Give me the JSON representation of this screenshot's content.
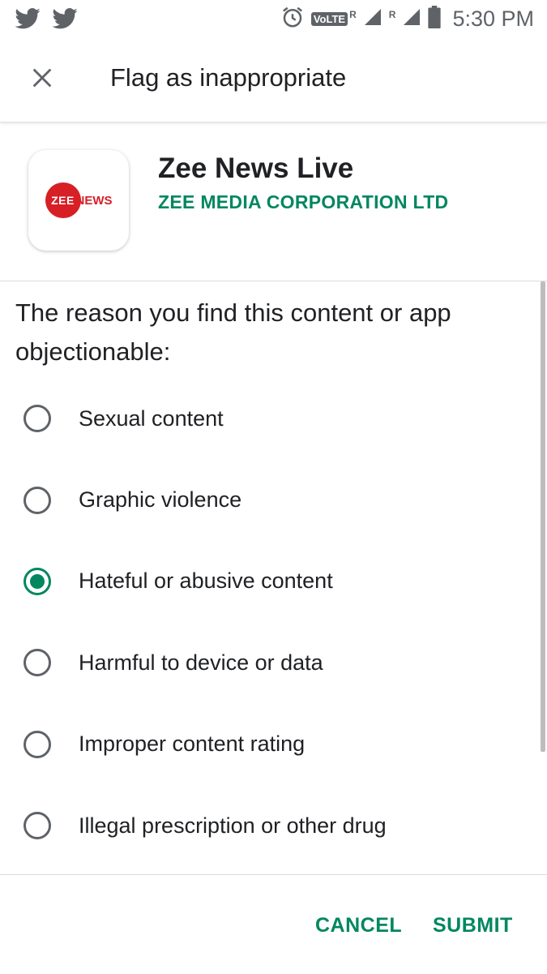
{
  "status_bar": {
    "left_icons": [
      "twitter-icon",
      "twitter-icon"
    ],
    "right_icons": [
      "alarm-icon",
      "volte-icon",
      "signal-icon",
      "signal-icon",
      "battery-icon"
    ],
    "volte_label": "VoLTE",
    "roaming_1": "R",
    "roaming_2": "R",
    "time": "5:30 PM"
  },
  "toolbar": {
    "close_icon": "close-icon",
    "title": "Flag as inappropriate"
  },
  "app": {
    "name": "Zee News Live",
    "developer": "ZEE MEDIA CORPORATION LTD",
    "logo_text_1": "ZEE",
    "logo_text_2": "NEWS"
  },
  "form": {
    "prompt": "The reason you find this content or app objectionable:",
    "options": [
      {
        "label": "Sexual content",
        "checked": false
      },
      {
        "label": "Graphic violence",
        "checked": false
      },
      {
        "label": "Hateful or abusive content",
        "checked": true
      },
      {
        "label": "Harmful to device or data",
        "checked": false
      },
      {
        "label": "Improper content rating",
        "checked": false
      },
      {
        "label": "Illegal prescription or other drug",
        "checked": false
      }
    ]
  },
  "actions": {
    "cancel": "CANCEL",
    "submit": "SUBMIT"
  },
  "colors": {
    "accent": "#01875f",
    "logo_red": "#d71f26"
  }
}
